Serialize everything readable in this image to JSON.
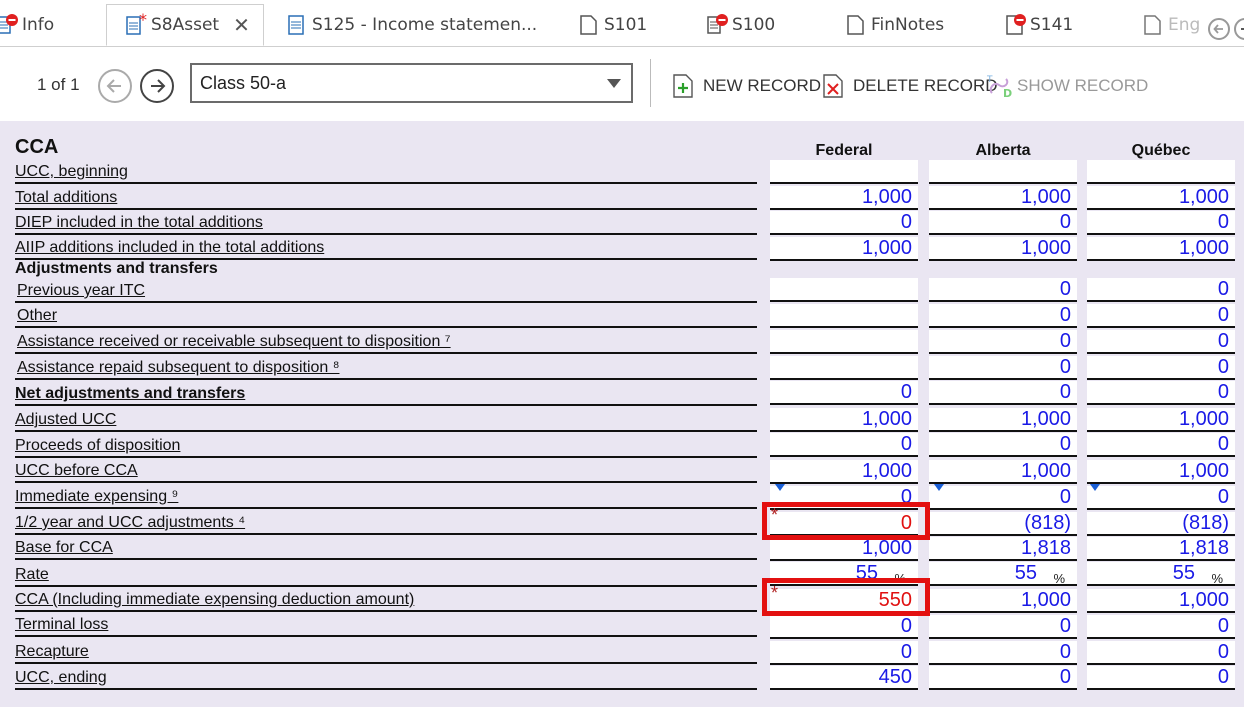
{
  "tabs": [
    {
      "label": "Info"
    },
    {
      "label": "S8Asset"
    },
    {
      "label": "S125 - Income statemen..."
    },
    {
      "label": "S101"
    },
    {
      "label": "S100"
    },
    {
      "label": "FinNotes"
    },
    {
      "label": "S141"
    },
    {
      "label": "Eng"
    }
  ],
  "tab_close": "✕",
  "toolbar": {
    "record_count": "1 of 1",
    "selected_class": "Class 50-a",
    "new_record": "NEW RECORD",
    "delete_record": "DELETE RECORD",
    "show_record": "SHOW RECORD"
  },
  "form": {
    "title": "CCA",
    "columns": [
      "Federal",
      "Alberta",
      "Québec"
    ],
    "percent_sign": "%",
    "required_marker": "*",
    "rows": [
      {
        "label": "UCC, beginning",
        "values": [
          "",
          "",
          ""
        ]
      },
      {
        "label": "Total additions",
        "values": [
          "1,000",
          "1,000",
          "1,000"
        ]
      },
      {
        "label": "DIEP included in the total additions",
        "values": [
          "0",
          "0",
          "0"
        ]
      },
      {
        "label": "AIIP additions included in the total additions",
        "values": [
          "1,000",
          "1,000",
          "1,000"
        ]
      },
      {
        "label": "Adjustments and transfers"
      },
      {
        "label": " Previous year ITC",
        "values": [
          "",
          "0",
          "0"
        ]
      },
      {
        "label": " Other",
        "values": [
          "",
          "0",
          "0"
        ]
      },
      {
        "label": " Assistance received or receivable subsequent to disposition ⁷",
        "values": [
          "",
          "0",
          "0"
        ]
      },
      {
        "label": " Assistance repaid subsequent to disposition ⁸",
        "values": [
          "",
          "0",
          "0"
        ]
      },
      {
        "label": "Net adjustments and transfers",
        "values": [
          "0",
          "0",
          "0"
        ]
      },
      {
        "label": "Adjusted UCC",
        "values": [
          "1,000",
          "1,000",
          "1,000"
        ]
      },
      {
        "label": "Proceeds of disposition",
        "values": [
          "0",
          "0",
          "0"
        ]
      },
      {
        "label": "UCC before CCA",
        "values": [
          "1,000",
          "1,000",
          "1,000"
        ]
      },
      {
        "label": "Immediate expensing ⁹",
        "values": [
          "0",
          "0",
          "0"
        ]
      },
      {
        "label": "1/2 year and UCC adjustments ⁴",
        "values": [
          "0",
          "(818)",
          "(818)"
        ]
      },
      {
        "label": "Base for CCA",
        "values": [
          "1,000",
          "1,818",
          "1,818"
        ]
      },
      {
        "label": "Rate",
        "values": [
          "55",
          "55",
          "55"
        ]
      },
      {
        "label": "CCA (Including immediate expensing deduction amount)",
        "values": [
          "550",
          "1,000",
          "1,000"
        ]
      },
      {
        "label": "Terminal loss",
        "values": [
          "0",
          "0",
          "0"
        ]
      },
      {
        "label": "Recapture",
        "values": [
          "0",
          "0",
          "0"
        ]
      },
      {
        "label": "UCC, ending",
        "values": [
          "450",
          "0",
          "0"
        ]
      }
    ]
  },
  "colors": {
    "value_blue": "#1a1ae6",
    "value_red": "#e01010",
    "highlight": "#e31010",
    "form_bg": "#eae6f2"
  }
}
